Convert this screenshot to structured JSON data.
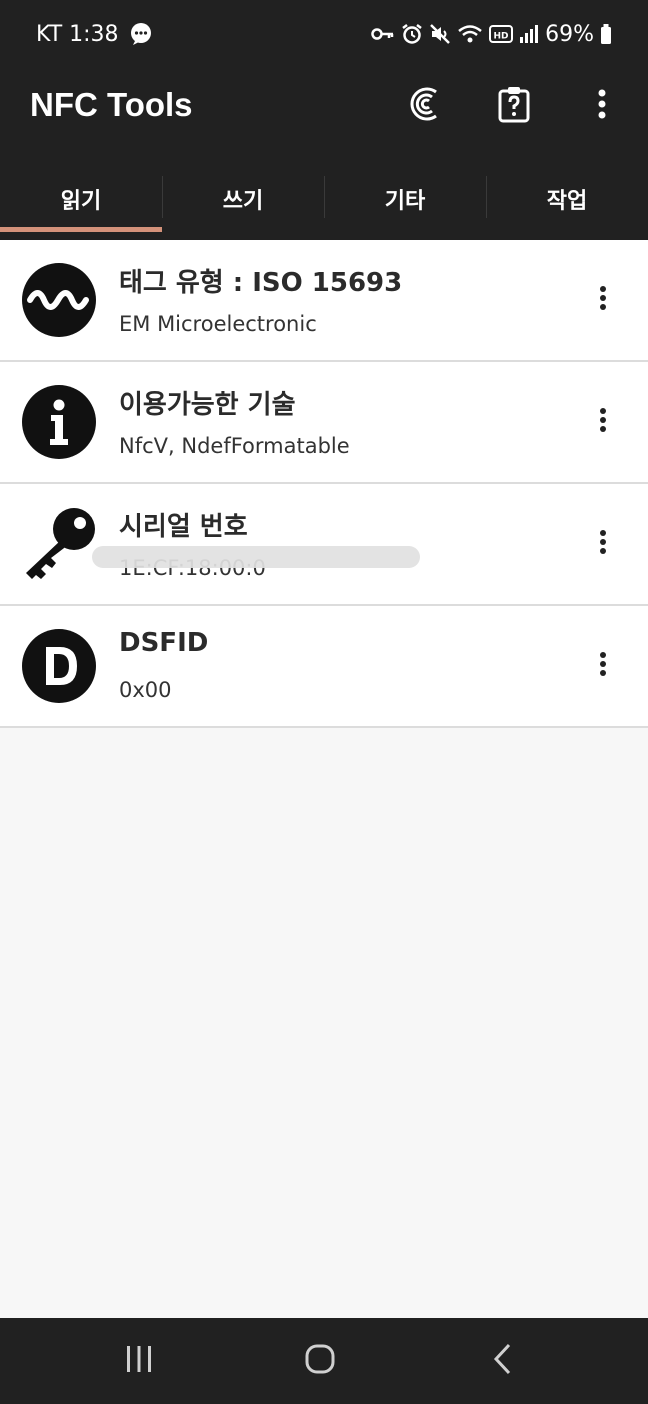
{
  "status_bar": {
    "carrier_time": "KT 1:38",
    "icons": [
      "chat-bubble-icon",
      "vpn-key-icon",
      "alarm-icon",
      "mute-icon",
      "wifi-icon",
      "hd-icon",
      "signal-icon",
      "battery-icon"
    ],
    "battery": "69%"
  },
  "app_bar": {
    "title": "NFC Tools",
    "actions": [
      "nfc-scan-icon",
      "clipboard-help-icon",
      "more-vertical-icon"
    ]
  },
  "tabs": [
    {
      "label": "읽기",
      "active": true
    },
    {
      "label": "쓰기",
      "active": false
    },
    {
      "label": "기타",
      "active": false
    },
    {
      "label": "작업",
      "active": false
    }
  ],
  "items": [
    {
      "icon": "wave-icon",
      "title": "태그 유형 : ISO 15693",
      "value": "EM Microelectronic"
    },
    {
      "icon": "info-icon",
      "title": "이용가능한 기술",
      "value": "NfcV, NdefFormatable"
    },
    {
      "icon": "key-icon",
      "title": "시리얼 번호",
      "value": "1E:CF:18:00:0",
      "redacted": true
    },
    {
      "icon": "letter-d-icon",
      "title": "DSFID",
      "value": "0x00"
    }
  ],
  "nav_bar": {
    "buttons": [
      "recent-apps-icon",
      "home-icon",
      "back-icon"
    ]
  },
  "colors": {
    "dark_bar": "#212121",
    "active_tab_underline": "#d4927a",
    "list_background": "#ffffff",
    "page_background": "#f7f7f7"
  }
}
